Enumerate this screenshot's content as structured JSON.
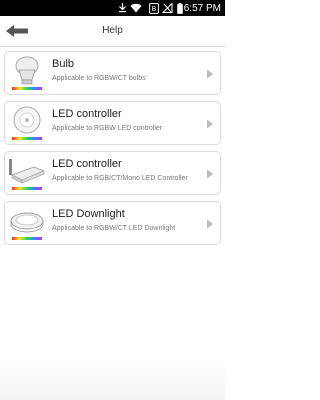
{
  "status_bar": {
    "time": "6:57 PM"
  },
  "header": {
    "title": "Help",
    "back_icon": "back-arrow-icon"
  },
  "devices": [
    {
      "title": "Bulb",
      "subtitle": "Applicable to RGBW/CT bulbs",
      "icon": "bulb-icon"
    },
    {
      "title": "LED controller",
      "subtitle": "Applicable to RGBW LED controller",
      "icon": "round-controller-icon"
    },
    {
      "title": "LED controller",
      "subtitle": "Applicable to RGB/CT/Mono LED Controller",
      "icon": "strip-controller-icon"
    },
    {
      "title": "LED Downlight",
      "subtitle": "Applicable to RGBW/CT LED Downlight",
      "icon": "downlight-icon"
    }
  ],
  "colors": {
    "status_bar": "#000000",
    "divider": "#d9d9d9",
    "card_border": "#dcdcdc",
    "title_text": "#222222",
    "subtitle_text": "#777777",
    "chevron": "#bbbbbb"
  }
}
